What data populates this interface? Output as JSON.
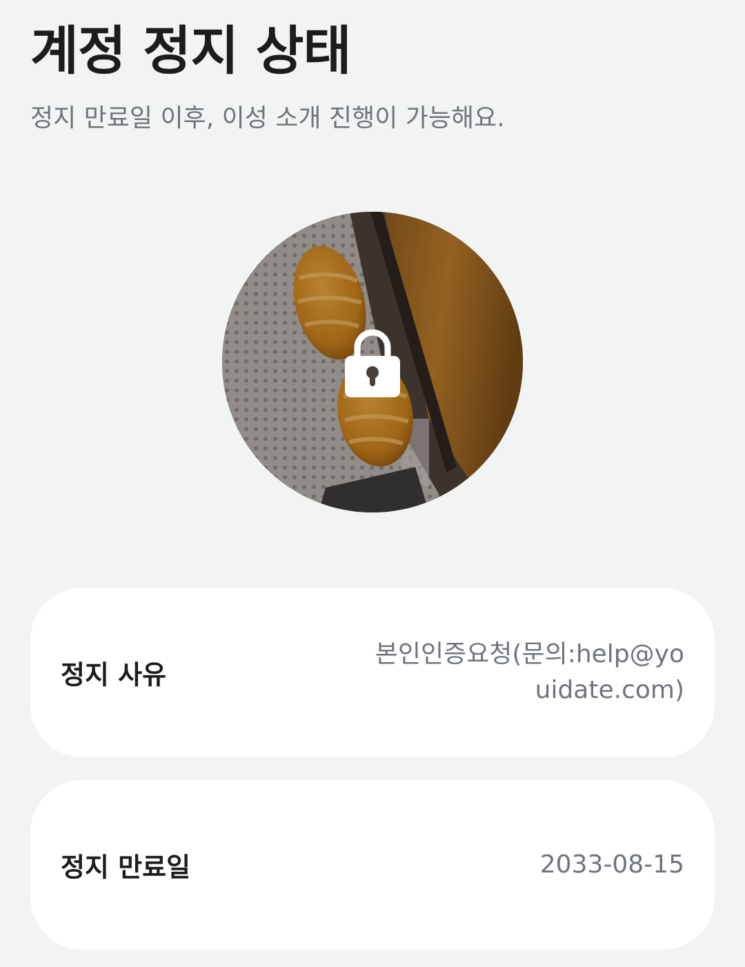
{
  "header": {
    "title": "계정 정지 상태",
    "subtitle": "정지 만료일 이후, 이성 소개 진행이 가능해요."
  },
  "profile": {
    "avatar_icon": "lock-icon",
    "avatar_description_icon": "profile-photo"
  },
  "info": {
    "reason_label": "정지 사유",
    "reason_value": "본인인증요청(문의:help@youidate.com)",
    "expiry_label": "정지 만료일",
    "expiry_value": "2033-08-15"
  },
  "colors": {
    "background": "#f2f4f3",
    "card": "#ffffff",
    "title": "#1c1c1e",
    "secondary_text": "#6e737c"
  }
}
